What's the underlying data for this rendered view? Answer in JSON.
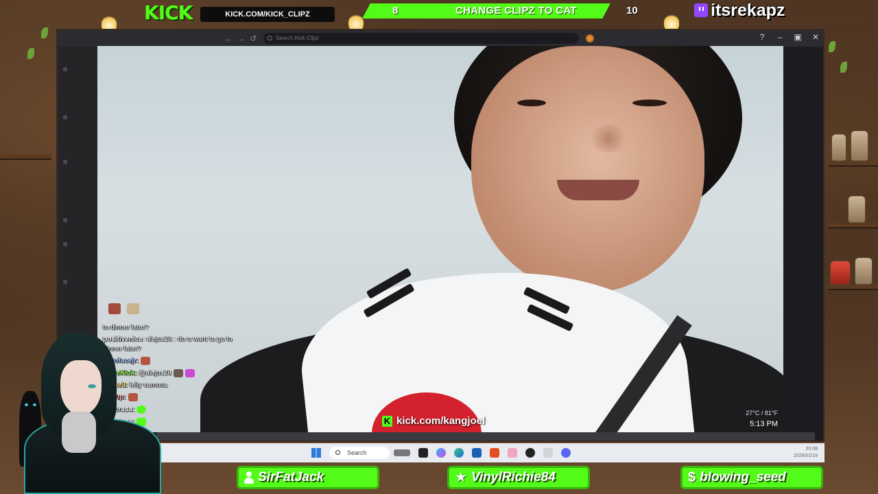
{
  "overlay": {
    "kick_logo": "KICK",
    "kick_url": "KICK.COM/KICK_CLIPZ",
    "vote": {
      "left_count": "8",
      "label": "CHANGE CLIPZ TO CAT",
      "right_count": "10"
    },
    "twitch_handle": "itsrekapz",
    "accent_color": "#53fc18"
  },
  "browser": {
    "search_placeholder": "Search Kick Clipz",
    "icons": [
      "back-icon",
      "forward-icon",
      "history-icon",
      "help-icon",
      "minimize-icon",
      "maximize-icon",
      "close-icon"
    ]
  },
  "video": {
    "channel_url": "kick.com/kangjoel",
    "weather": "27°C / 81°F",
    "time": "5:13 PM"
  },
  "chat": {
    "lines": [
      {
        "user": "",
        "text": "to dinner later?"
      },
      {
        "user": "positivenice",
        "text": ": alejus28 : do u want to go to"
      },
      {
        "user": "",
        "text": "dinner later?"
      },
      {
        "user": "bofacejr:",
        "text": ""
      },
      {
        "user": "reeKick:",
        "text": "@alejus28"
      },
      {
        "user": "me3:",
        "text": "lelly vamous"
      },
      {
        "user": "00p:",
        "text": ""
      },
      {
        "user": "Scrasa:",
        "text": ""
      },
      {
        "user": "Scrasa:",
        "text": ""
      }
    ]
  },
  "taskbar": {
    "search_label": "Search",
    "time": "20:08",
    "date": "2026/02/19"
  },
  "bottom_bars": [
    {
      "name": "SirFatJack",
      "icon": "person-icon"
    },
    {
      "name": "VinylRichie84",
      "icon": "star-icon"
    },
    {
      "name": "blowing_seed",
      "icon": "dollar-icon"
    }
  ]
}
